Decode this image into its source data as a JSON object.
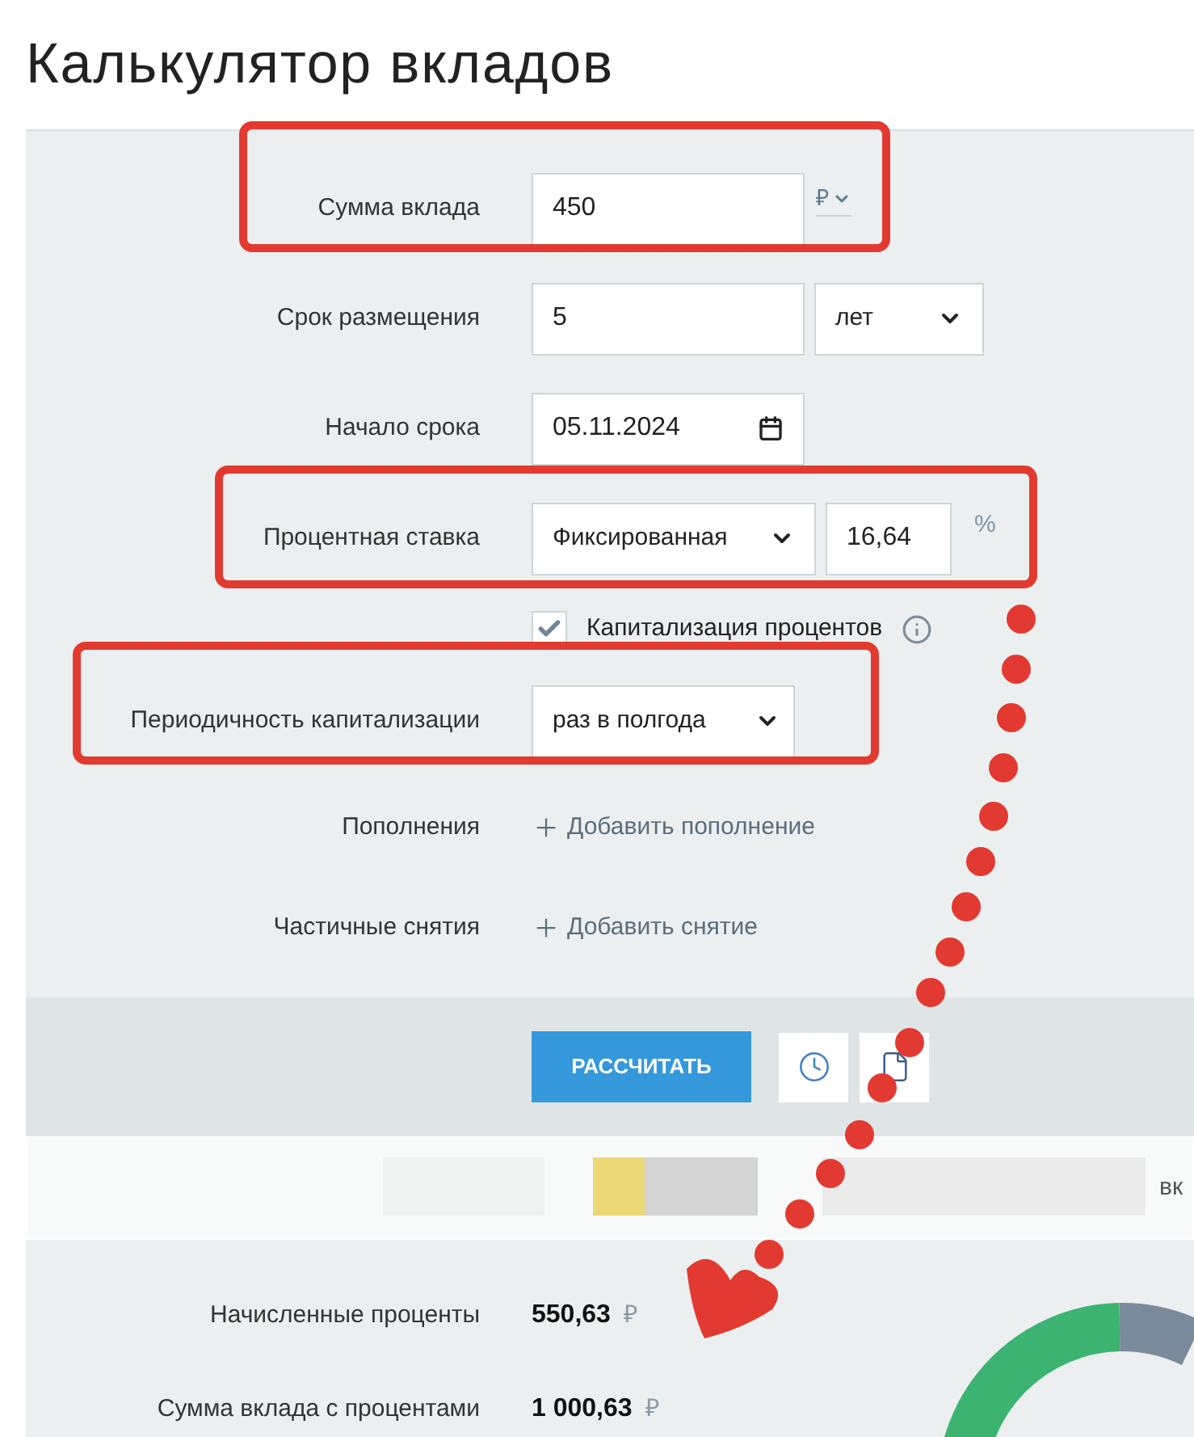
{
  "page": {
    "title": "Калькулятор вкладов"
  },
  "form": {
    "rows": [
      {
        "kind": "amount",
        "label": "Сумма вклада",
        "value": "450",
        "currency": "₽"
      },
      {
        "kind": "term",
        "label": "Срок размещения",
        "value": "5",
        "unit": "лет"
      },
      {
        "kind": "date",
        "label": "Начало срока",
        "value": "05.11.2024"
      },
      {
        "kind": "rate",
        "label": "Процентная ставка",
        "rate_type": "Фиксированная",
        "value": "16,64",
        "suffix": "%"
      },
      {
        "kind": "checkbox",
        "label": "Капитализация процентов",
        "checked": true
      },
      {
        "kind": "select",
        "label": "Периодичность капитализации",
        "value": "раз в полгода"
      },
      {
        "kind": "link",
        "label": "Пополнения",
        "link": "Добавить пополнение"
      },
      {
        "kind": "link",
        "label": "Частичные снятия",
        "link": "Добавить снятие"
      }
    ]
  },
  "actions": {
    "calculate": "РАССЧИТАТЬ"
  },
  "banner": {
    "text": "вк"
  },
  "results": [
    {
      "label": "Начисленные проценты",
      "value": "550,63",
      "currency": "₽"
    },
    {
      "label": "Сумма вклада с процентами",
      "value": "1 000,63",
      "currency": "₽"
    }
  ]
}
